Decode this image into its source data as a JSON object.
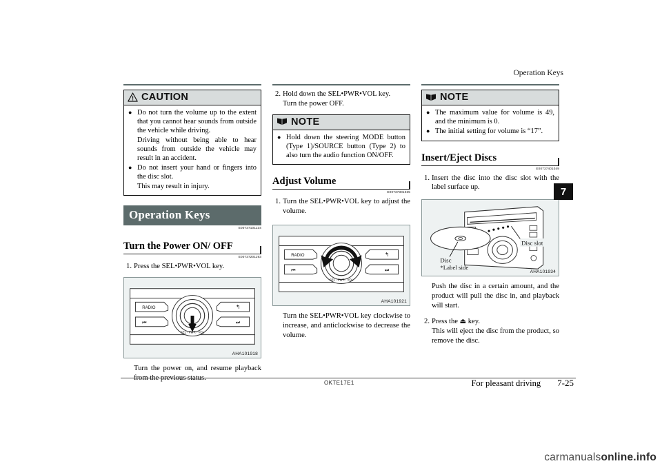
{
  "header": {
    "running_title": "Operation Keys"
  },
  "chapter_tab": "7",
  "footer": {
    "doc_code": "OKTE17E1",
    "chapter_title": "For pleasant driving",
    "page_number": "7-25"
  },
  "watermark": {
    "prefix": "carmanuals",
    "suffix": "online.info"
  },
  "column_left": {
    "caution": {
      "icon": "warning-triangle-icon",
      "title": "CAUTION",
      "bullets": [
        [
          "Do not turn the volume up to the extent that you cannot hear sounds from outside the vehicle while driving.",
          "Driving without being able to hear sounds from outside the vehicle may result in an accident."
        ],
        [
          "Do not insert your hand or fingers into the disc slot.",
          "This may result in injury."
        ]
      ]
    },
    "banner": "Operation Keys",
    "banner_refcode": "E00737101134",
    "section": {
      "title": "Turn the Power ON/ OFF",
      "refcode": "E00737201193",
      "steps": [
        {
          "num": "1.",
          "lines": [
            "Press the SEL•PWR•VOL key."
          ]
        }
      ]
    },
    "figure": {
      "id": "AHA101918",
      "labels": {
        "radio": "RADIO",
        "prev": "❘◀◀",
        "next": "▶▶❘",
        "back": "↶",
        "knob": "SEL · PWR · VOL"
      }
    },
    "caption": "Turn the power on, and resume playback from the previous status."
  },
  "column_middle": {
    "steps": [
      {
        "num": "2.",
        "lines": [
          "Hold down the SEL•PWR•VOL key.",
          "Turn the power OFF."
        ]
      }
    ],
    "note": {
      "icon": "note-book-icon",
      "title": "NOTE",
      "bullets": [
        [
          "Hold down the steering MODE button (Type 1)/SOURCE button (Type 2) to also turn the audio function ON/OFF."
        ]
      ]
    },
    "section": {
      "title": "Adjust Volume",
      "refcode": "E00737301035",
      "steps": [
        {
          "num": "1.",
          "lines": [
            "Turn the SEL•PWR•VOL key to adjust the volume."
          ]
        }
      ]
    },
    "figure": {
      "id": "AHA101921",
      "labels": {
        "radio": "RADIO",
        "prev": "❘◀◀",
        "next": "▶▶❘",
        "back": "↶",
        "knob": "SEL · PWR · VOL"
      }
    },
    "caption": "Turn the SEL•PWR•VOL key clockwise to increase, and anticlockwise to decrease the volume."
  },
  "column_right": {
    "note": {
      "icon": "note-book-icon",
      "title": "NOTE",
      "bullets": [
        [
          "The maximum value for volume is 49, and the minimum is 0."
        ],
        [
          "The initial setting for volume is “17”."
        ]
      ]
    },
    "section": {
      "title": "Insert/Eject Discs",
      "refcode": "E00737401049",
      "steps": [
        {
          "num": "1.",
          "lines": [
            "Insert the disc into the disc slot with the label surface up."
          ]
        }
      ]
    },
    "figure": {
      "id": "AHA101934",
      "labels": {
        "disc_slot": "Disc slot",
        "disc": "Disc",
        "label_side": "*Label side"
      }
    },
    "para": "Push the disc in a certain amount, and the product will pull the disc in, and playback will start.",
    "steps2": [
      {
        "num": "2.",
        "pre": "Press the ",
        "glyph": "⏏",
        "post": " key.",
        "lines": [
          "This will eject the disc from the product, so remove the disc."
        ]
      }
    ]
  }
}
